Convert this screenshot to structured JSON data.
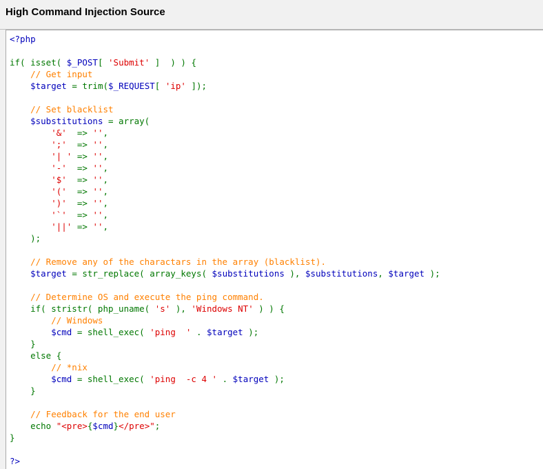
{
  "header": {
    "title": "High Command Injection Source"
  },
  "colors": {
    "html": "#0000bb",
    "keyword": "#007700",
    "variable": "#0000bb",
    "string": "#dd0000",
    "comment": "#ff8000"
  },
  "source": {
    "lines": [
      [
        [
          "html",
          "<?php"
        ]
      ],
      [],
      [
        [
          "plain",
          "if( isset( "
        ],
        [
          "var",
          "$_POST"
        ],
        [
          "plain",
          "[ "
        ],
        [
          "string",
          "'Submit'"
        ],
        [
          "plain",
          " ]  ) ) {"
        ]
      ],
      [
        [
          "comment",
          "    // Get input"
        ]
      ],
      [
        [
          "plain",
          "    "
        ],
        [
          "var",
          "$target"
        ],
        [
          "plain",
          " = trim("
        ],
        [
          "var",
          "$_REQUEST"
        ],
        [
          "plain",
          "[ "
        ],
        [
          "string",
          "'ip'"
        ],
        [
          "plain",
          " ]);"
        ]
      ],
      [],
      [
        [
          "comment",
          "    // Set blacklist"
        ]
      ],
      [
        [
          "plain",
          "    "
        ],
        [
          "var",
          "$substitutions"
        ],
        [
          "plain",
          " = array("
        ]
      ],
      [
        [
          "plain",
          "        "
        ],
        [
          "string",
          "'&'"
        ],
        [
          "plain",
          "  => "
        ],
        [
          "string",
          "''"
        ],
        [
          "plain",
          ","
        ]
      ],
      [
        [
          "plain",
          "        "
        ],
        [
          "string",
          "';'"
        ],
        [
          "plain",
          "  => "
        ],
        [
          "string",
          "''"
        ],
        [
          "plain",
          ","
        ]
      ],
      [
        [
          "plain",
          "        "
        ],
        [
          "string",
          "'| '"
        ],
        [
          "plain",
          " => "
        ],
        [
          "string",
          "''"
        ],
        [
          "plain",
          ","
        ]
      ],
      [
        [
          "plain",
          "        "
        ],
        [
          "string",
          "'-'"
        ],
        [
          "plain",
          "  => "
        ],
        [
          "string",
          "''"
        ],
        [
          "plain",
          ","
        ]
      ],
      [
        [
          "plain",
          "        "
        ],
        [
          "string",
          "'$'"
        ],
        [
          "plain",
          "  => "
        ],
        [
          "string",
          "''"
        ],
        [
          "plain",
          ","
        ]
      ],
      [
        [
          "plain",
          "        "
        ],
        [
          "string",
          "'('"
        ],
        [
          "plain",
          "  => "
        ],
        [
          "string",
          "''"
        ],
        [
          "plain",
          ","
        ]
      ],
      [
        [
          "plain",
          "        "
        ],
        [
          "string",
          "')'"
        ],
        [
          "plain",
          "  => "
        ],
        [
          "string",
          "''"
        ],
        [
          "plain",
          ","
        ]
      ],
      [
        [
          "plain",
          "        "
        ],
        [
          "string",
          "'`'"
        ],
        [
          "plain",
          "  => "
        ],
        [
          "string",
          "''"
        ],
        [
          "plain",
          ","
        ]
      ],
      [
        [
          "plain",
          "        "
        ],
        [
          "string",
          "'||'"
        ],
        [
          "plain",
          " => "
        ],
        [
          "string",
          "''"
        ],
        [
          "plain",
          ","
        ]
      ],
      [
        [
          "plain",
          "    );"
        ]
      ],
      [],
      [
        [
          "comment",
          "    // Remove any of the charactars in the array (blacklist)."
        ]
      ],
      [
        [
          "plain",
          "    "
        ],
        [
          "var",
          "$target"
        ],
        [
          "plain",
          " = str_replace( array_keys( "
        ],
        [
          "var",
          "$substitutions"
        ],
        [
          "plain",
          " ), "
        ],
        [
          "var",
          "$substitutions"
        ],
        [
          "plain",
          ", "
        ],
        [
          "var",
          "$target"
        ],
        [
          "plain",
          " );"
        ]
      ],
      [],
      [
        [
          "comment",
          "    // Determine OS and execute the ping command."
        ]
      ],
      [
        [
          "plain",
          "    if( stristr( php_uname( "
        ],
        [
          "string",
          "'s'"
        ],
        [
          "plain",
          " ), "
        ],
        [
          "string",
          "'Windows NT'"
        ],
        [
          "plain",
          " ) ) {"
        ]
      ],
      [
        [
          "comment",
          "        // Windows"
        ]
      ],
      [
        [
          "plain",
          "        "
        ],
        [
          "var",
          "$cmd"
        ],
        [
          "plain",
          " = shell_exec( "
        ],
        [
          "string",
          "'ping  '"
        ],
        [
          "plain",
          " . "
        ],
        [
          "var",
          "$target"
        ],
        [
          "plain",
          " );"
        ]
      ],
      [
        [
          "plain",
          "    }"
        ]
      ],
      [
        [
          "plain",
          "    else {"
        ]
      ],
      [
        [
          "comment",
          "        // *nix"
        ]
      ],
      [
        [
          "plain",
          "        "
        ],
        [
          "var",
          "$cmd"
        ],
        [
          "plain",
          " = shell_exec( "
        ],
        [
          "string",
          "'ping  -c 4 '"
        ],
        [
          "plain",
          " . "
        ],
        [
          "var",
          "$target"
        ],
        [
          "plain",
          " );"
        ]
      ],
      [
        [
          "plain",
          "    }"
        ]
      ],
      [],
      [
        [
          "comment",
          "    // Feedback for the end user"
        ]
      ],
      [
        [
          "plain",
          "    echo "
        ],
        [
          "string",
          "\"<pre>"
        ],
        [
          "plain",
          "{"
        ],
        [
          "var",
          "$cmd"
        ],
        [
          "plain",
          "}"
        ],
        [
          "string",
          "</pre>\""
        ],
        [
          "plain",
          ";"
        ]
      ],
      [
        [
          "plain",
          "}"
        ]
      ],
      [],
      [
        [
          "html",
          "?>"
        ]
      ]
    ]
  }
}
